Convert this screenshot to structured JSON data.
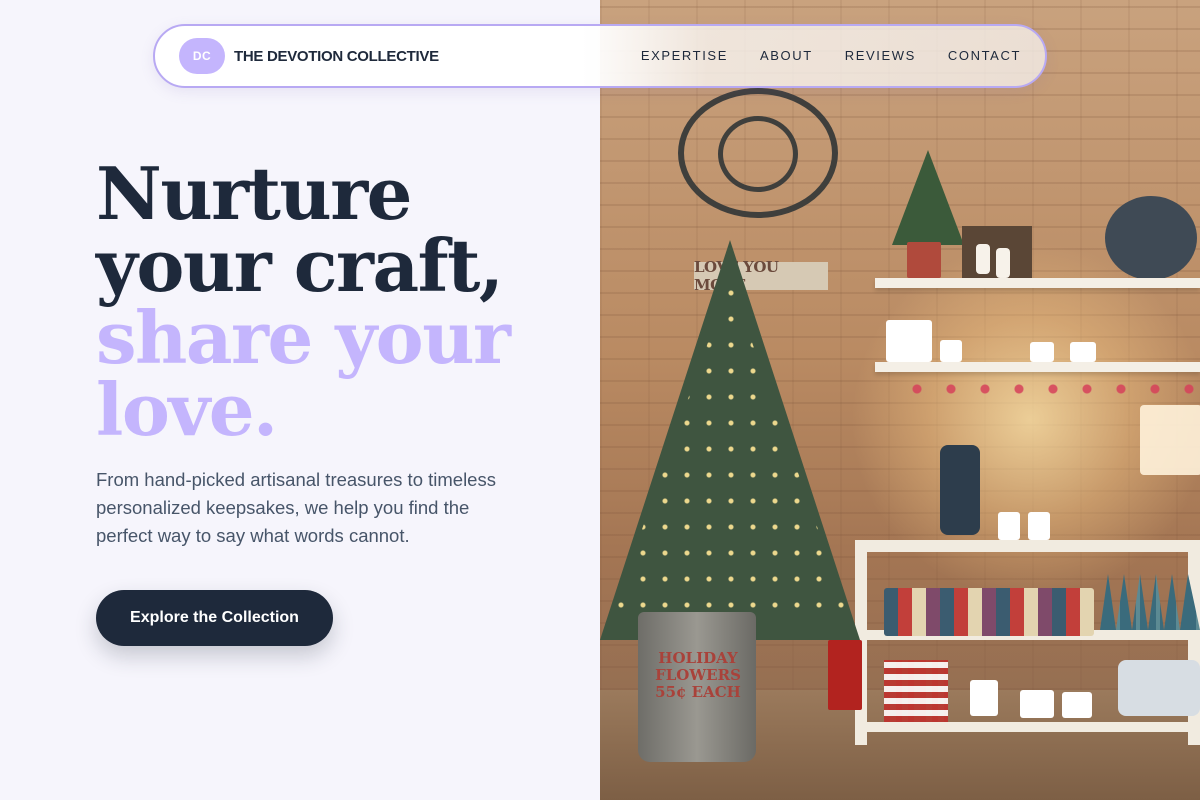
{
  "brand": {
    "initials": "DC",
    "name": "THE DEVOTION COLLECTIVE"
  },
  "nav": {
    "links": [
      "EXPERTISE",
      "ABOUT",
      "REVIEWS",
      "CONTACT"
    ]
  },
  "hero": {
    "headline_lines": [
      "Nurture",
      "your craft,",
      "share your",
      "love."
    ],
    "description": "From hand-picked artisanal treasures to timeless personalized keepsakes, we help you find the perfect way to say what words cannot.",
    "cta_label": "Explore the Collection"
  },
  "photo": {
    "sign_text": "LOVE YOU MORE",
    "bucket_text": "HOLIDAY FLOWERS 55¢ EACH"
  },
  "colors": {
    "background": "#f6f5fc",
    "text_dark": "#1e293b",
    "accent": "#c4b5fd",
    "nav_border": "#b8a9f3",
    "body_text": "#475569"
  }
}
